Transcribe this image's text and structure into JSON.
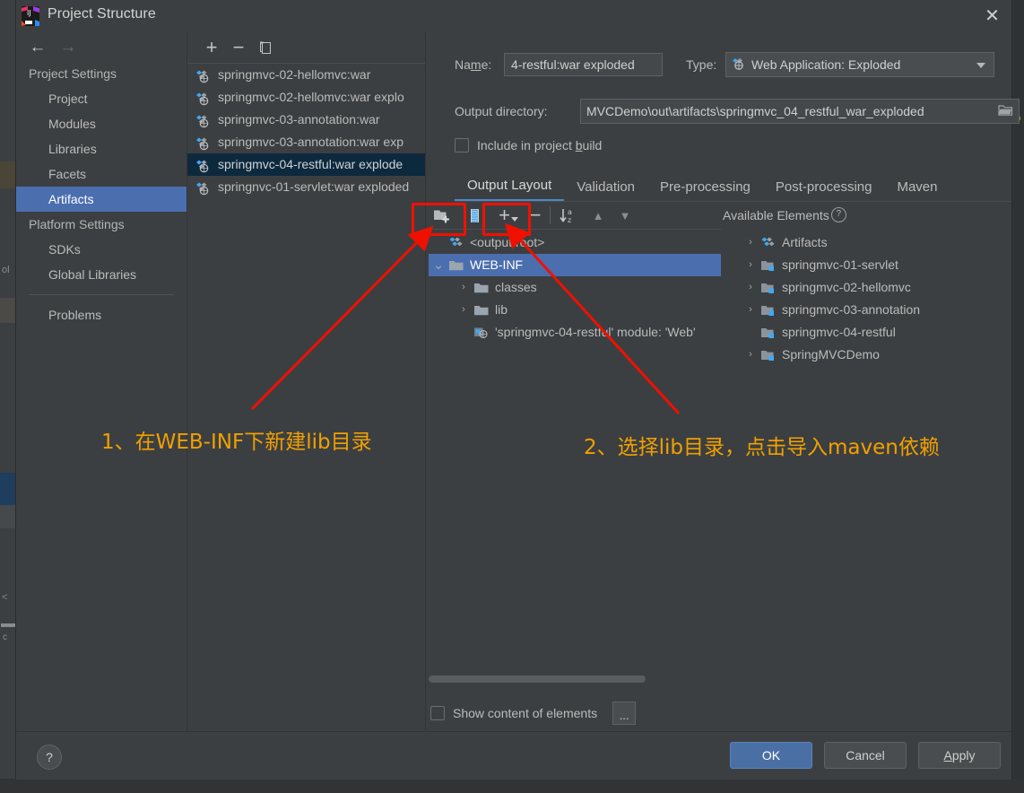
{
  "window": {
    "title": "Project Structure",
    "icon": "intellij-idea-logo",
    "close_label": "✕"
  },
  "sidebar": {
    "back_icon": "←",
    "forward_icon": "→",
    "groups": [
      {
        "label": "Project Settings",
        "items": [
          {
            "label": "Project",
            "selected": false
          },
          {
            "label": "Modules",
            "selected": false
          },
          {
            "label": "Libraries",
            "selected": false
          },
          {
            "label": "Facets",
            "selected": false
          },
          {
            "label": "Artifacts",
            "selected": true
          }
        ]
      },
      {
        "label": "Platform Settings",
        "items": [
          {
            "label": "SDKs",
            "selected": false
          },
          {
            "label": "Global Libraries",
            "selected": false
          }
        ]
      }
    ],
    "problems": "Problems"
  },
  "artifact_list": {
    "toolbar": {
      "add": "+",
      "remove": "−",
      "copy_icon": "copy-icon"
    },
    "items": [
      {
        "label": "springmvc-02-hellomvc:war",
        "selected": false
      },
      {
        "label": "springmvc-02-hellomvc:war explo",
        "selected": false
      },
      {
        "label": "springmvc-03-annotation:war",
        "selected": false
      },
      {
        "label": "springmvc-03-annotation:war exp",
        "selected": false
      },
      {
        "label": "springmvc-04-restful:war explode",
        "selected": true
      },
      {
        "label": "springnvc-01-servlet:war exploded",
        "selected": false
      }
    ]
  },
  "detail": {
    "name_label": "Name:",
    "name_value": "4-restful:war exploded",
    "type_label": "Type:",
    "type_value": "Web Application: Exploded",
    "output_dir_label": "Output directory:",
    "output_dir_value": "MVCDemo\\out\\artifacts\\springmvc_04_restful_war_exploded",
    "include_in_build_label": "Include in project build",
    "include_in_build_checked": false,
    "tabs": [
      {
        "label": "Output Layout",
        "active": true
      },
      {
        "label": "Validation",
        "active": false
      },
      {
        "label": "Pre-processing",
        "active": false
      },
      {
        "label": "Post-processing",
        "active": false
      },
      {
        "label": "Maven",
        "active": false
      }
    ],
    "layout_toolbar": {
      "create_directory": "create-directory-icon",
      "create_archive": "create-archive-icon",
      "add": "+",
      "remove": "−",
      "sort": "sort-alphabetically-icon",
      "move_up": "▲",
      "move_down": "▼"
    },
    "layout_tree": [
      {
        "label": "<output root>",
        "icon": "artifact-icon",
        "indent": 0,
        "chevron": "none",
        "selected": false
      },
      {
        "label": "WEB-INF",
        "icon": "folder-icon",
        "indent": 0,
        "chevron": "expanded",
        "selected": true
      },
      {
        "label": "classes",
        "icon": "folder-icon",
        "indent": 1,
        "chevron": "collapsed",
        "selected": false
      },
      {
        "label": "lib",
        "icon": "folder-icon",
        "indent": 1,
        "chevron": "collapsed",
        "selected": false
      },
      {
        "label": "'springmvc-04-restful' module: 'Web'",
        "icon": "module-web-icon",
        "indent": 1,
        "chevron": "none",
        "selected": false
      }
    ],
    "available_title": "Available Elements",
    "available_help_icon": "?",
    "available_tree": [
      {
        "label": "Artifacts",
        "icon": "artifact-icon",
        "chevron": "collapsed"
      },
      {
        "label": "springmvc-01-servlet",
        "icon": "module-icon",
        "chevron": "collapsed"
      },
      {
        "label": "springmvc-02-hellomvc",
        "icon": "module-icon",
        "chevron": "collapsed"
      },
      {
        "label": "springmvc-03-annotation",
        "icon": "module-icon",
        "chevron": "collapsed"
      },
      {
        "label": "springmvc-04-restful",
        "icon": "module-icon",
        "chevron": "none"
      },
      {
        "label": "SpringMVCDemo",
        "icon": "module-icon",
        "chevron": "collapsed"
      }
    ],
    "show_content_label": "Show content of elements",
    "show_content_checked": false,
    "dots_button": "..."
  },
  "footer": {
    "help": "?",
    "ok": "OK",
    "cancel": "Cancel",
    "apply_pre": "A",
    "apply_rest": "pply"
  },
  "annotations": {
    "step1": "1、在WEB-INF下新建lib目录",
    "step2": "2、选择lib目录，点击导入maven依赖",
    "color": "#f0a000",
    "marker_color": "#f01000"
  }
}
